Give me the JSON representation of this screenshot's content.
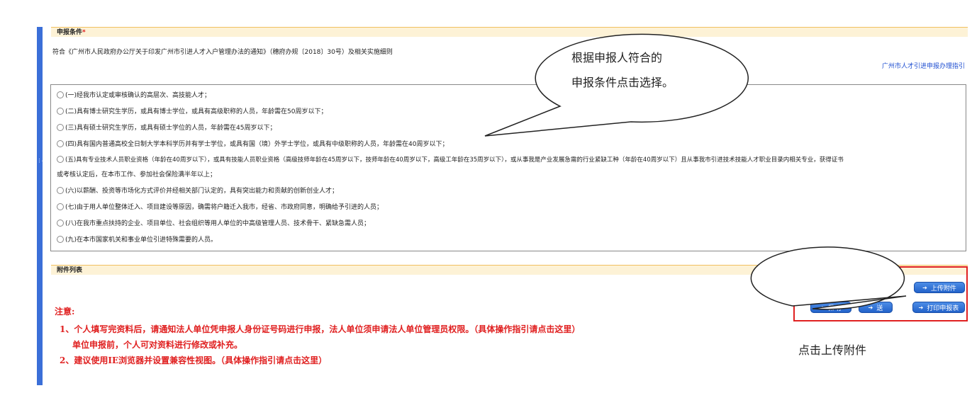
{
  "sidebar": {
    "toggle_glyph": "⋮◀⋮"
  },
  "conditions_section": {
    "title": "申报条件",
    "required_mark": "*",
    "description": "符合《广州市人民政府办公厅关于印发广州市引进人才入户管理办法的通知》（穗府办规〔2018〕30号）及相关实施细则",
    "guide_link": "广州市人才引进申报办理指引",
    "options": [
      "(一)经我市认定或审核确认的高层次、高技能人才；",
      "(二)具有博士研究生学历，或具有博士学位，或具有高级职称的人员，年龄需在50周岁以下；",
      "(三)具有硕士研究生学历，或具有硕士学位的人员，年龄需在45周岁以下；",
      "(四)具有国内普通高校全日制大学本科学历并有学士学位，或具有国（境）外学士学位，或具有中级职称的人员，年龄需在40周岁以下；",
      "(五)具有专业技术人员职业资格（年龄在40周岁以下），或具有技能人员职业资格（高级技师年龄在45周岁以下，技师年龄在40周岁以下，高级工年龄在35周岁以下），或从事我是产业发展急需的行业紧缺工种（年龄在40周岁以下）且从事我市引进技术技能人才职业目录内相关专业，获得证书",
      "(六)以薪酬、投资等市场化方式评价并经相关部门认定的，具有突出能力和贡献的创新创业人才；",
      "(七)由于用人单位整体迁入、项目建设等原因，确需将户籍迁入我市，经省、市政府同意，明确给予引进的人员；",
      "(八)在我市重点扶持的企业、项目单位、社会组织等用人单位的中高级管理人员、技术骨干、紧缺急需人员；",
      "(九)在本市国家机关和事业单位引进特殊需要的人员。"
    ],
    "option5_continuation": "或考核认定后，在本市工作、参加社会保险满半年以上；"
  },
  "attachments_section": {
    "title": "附件列表"
  },
  "notice": {
    "title": "注意:",
    "line1": "1、个人填写完资料后，请通知法人单位凭申报人身份证号码进行申报，法人单位须申请法人单位管理员权限。（具体操作指引请点击这里）",
    "line1b": "单位申报前，个人可对资料进行修改或补充。",
    "line2": "2、建议使用IE浏览器并设置兼容性视图。（具体操作指引请点击这里）"
  },
  "buttons": {
    "upload": "上传附件",
    "save": "保 存",
    "submit_partial": "送",
    "print": "打印申报表",
    "icon": "arrow-circle-icon"
  },
  "callouts": {
    "conditions_line1": "根据申报人符合的",
    "conditions_line2": "申报条件点击选择。",
    "upload": "点击上传附件"
  },
  "colors": {
    "accent_blue": "#3b6fd8",
    "section_bg": "#fdf2d6",
    "notice_red": "#e02020",
    "link_blue": "#1f4fd1"
  }
}
